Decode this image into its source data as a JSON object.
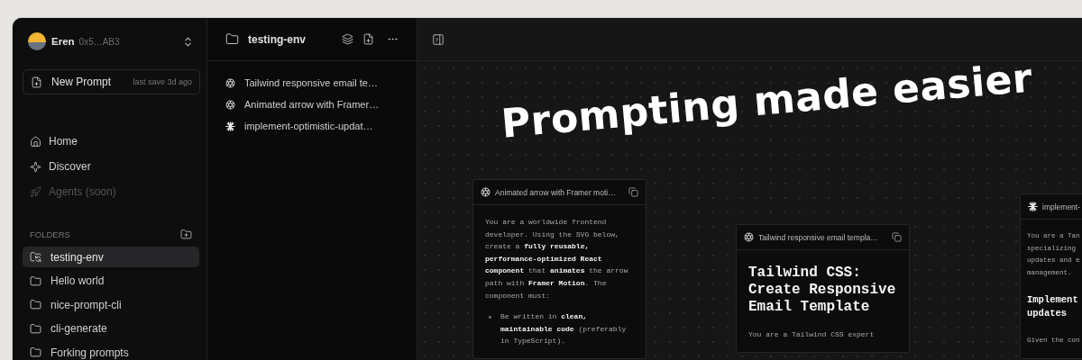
{
  "sidebar": {
    "user": {
      "name": "Eren",
      "address": "0x5…AB3"
    },
    "new_prompt": {
      "label": "New Prompt",
      "note": "last save 3d ago"
    },
    "nav": [
      {
        "label": "Home",
        "kind": "home",
        "disabled": false
      },
      {
        "label": "Discover",
        "kind": "discover",
        "disabled": false
      },
      {
        "label": "Agents (soon)",
        "kind": "agents",
        "disabled": true
      }
    ],
    "folders_heading": "FOLDERS",
    "folders": [
      {
        "name": "testing-env",
        "selected": true
      },
      {
        "name": "Hello world",
        "selected": false
      },
      {
        "name": "nice-prompt-cli",
        "selected": false
      },
      {
        "name": "cli-generate",
        "selected": false
      },
      {
        "name": "Forking prompts",
        "selected": false
      }
    ]
  },
  "folder_panel": {
    "title": "testing-env",
    "prompts": [
      {
        "title": "Tailwind responsive email te…",
        "kind": "swirl"
      },
      {
        "title": "Animated arrow with Framer…",
        "kind": "swirl"
      },
      {
        "title": "implement-optimistic-updat…",
        "kind": "burst"
      }
    ]
  },
  "canvas": {
    "headline": "Prompting made easier",
    "cards": [
      {
        "title": "Animated arrow with Framer moti…",
        "kind": "swirl",
        "blocks": [
          {
            "kind": "paragraph",
            "text": "You are a worldwide frontend developer. Using the SVG below, create a **fully reusable, performance-optimized React component** that **animates** the arrow path with **Framer Motion**. The component must:"
          },
          {
            "kind": "bullet",
            "text": "Be written in **clean, maintainable code** (preferably in TypeScript)."
          }
        ]
      },
      {
        "title": "Tailwind responsive email templa…",
        "kind": "swirl",
        "blocks": [
          {
            "kind": "heading",
            "text": "Tailwind CSS: Create Responsive Email Template"
          },
          {
            "kind": "paragraph",
            "text": "You are a Tailwind CSS expert"
          }
        ]
      },
      {
        "title": "implement-",
        "kind": "burst",
        "blocks": [
          {
            "kind": "lines",
            "lines": [
              "You are a Tan",
              "specializing",
              "updates and e",
              "management."
            ]
          },
          {
            "kind": "heading_lines",
            "lines": [
              "Implement",
              "updates"
            ]
          },
          {
            "kind": "lines",
            "lines": [
              "Given the con"
            ]
          }
        ]
      }
    ]
  }
}
